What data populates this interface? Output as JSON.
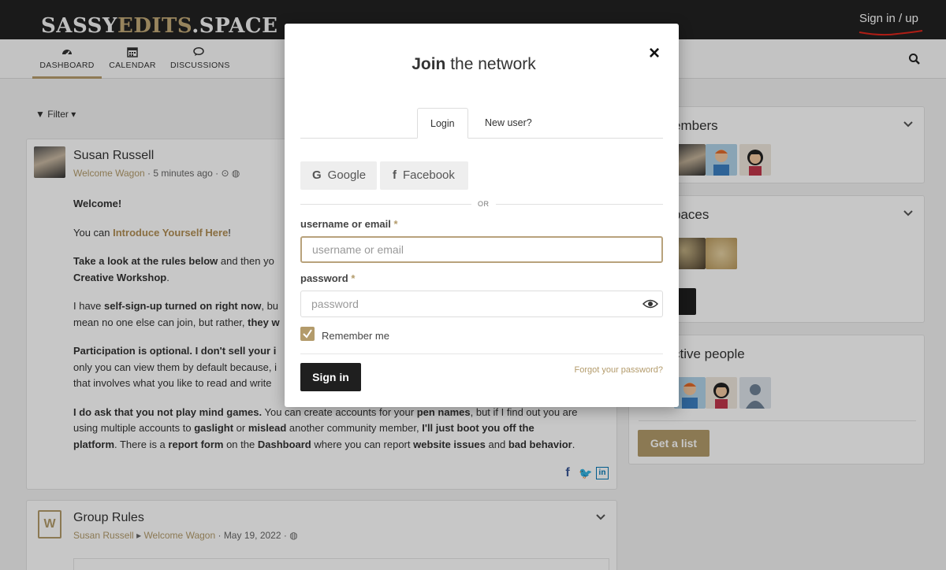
{
  "site": {
    "logo_part1": "SASSY",
    "logo_part2": "EDITS",
    "logo_part3": ".SPACE",
    "signin_link": "Sign in / up",
    "accent_color": "#b39b6b"
  },
  "nav": {
    "items": [
      {
        "label": "DASHBOARD",
        "icon": "dashboard-icon"
      },
      {
        "label": "CALENDAR",
        "icon": "calendar-icon"
      },
      {
        "label": "DISCUSSIONS",
        "icon": "comments-icon"
      }
    ],
    "search_icon": "search-icon"
  },
  "filter_label": "Filter",
  "post1": {
    "author": "Susan Russell",
    "group": "Welcome Wagon",
    "time": "5 minutes ago",
    "p1": "Welcome!",
    "p2_pre": "You can ",
    "p2_link": "Introduce Yourself Here",
    "p2_post": "!",
    "p3_bold": "Take a look at the rules below",
    "p3_rest": " and then yo",
    "p3_line2": "Creative Workshop",
    "p3_line2_end": ".",
    "p4_a": "I have ",
    "p4_b": "self-sign-up turned on right now",
    "p4_c": ", bu",
    "p4_line2_a": "mean no one else can join, but rather, ",
    "p4_line2_b": "they w",
    "p5_a": "Participation is optional. I don't sell your i",
    "p5_line2": "only you can view them by default because, i",
    "p5_line3": "that involves what you like to read and write",
    "p6_a": "I do ask that you not play mind games.",
    "p6_b": " You can create accounts for your ",
    "p6_c": "pen names",
    "p6_d": ", but if I find out you are",
    "p6_line2_a": "using multiple accounts to ",
    "p6_line2_b": "gaslight",
    "p6_line2_c": " or ",
    "p6_line2_d": "mislead",
    "p6_line2_e": " another community member, ",
    "p6_line2_f": "I'll just boot you off the",
    "p6_line3_a": "platform",
    "p6_line3_b": ". There is a ",
    "p6_line3_c": "report form",
    "p6_line3_d": " on the ",
    "p6_line3_e": "Dashboard",
    "p6_line3_f": " where you can report ",
    "p6_line3_g": "website issues",
    "p6_line3_h": " and ",
    "p6_line3_i": "bad behavior",
    "p6_line3_j": "."
  },
  "post2": {
    "title": "Group Rules",
    "author": "Susan Russell",
    "group": "Welcome Wagon",
    "date": "May 19, 2022"
  },
  "sidebar": {
    "members_title": "embers",
    "spaces_title": "paces",
    "active_title": "ctive people",
    "list_button": "Get a list"
  },
  "modal": {
    "title_bold": "Join",
    "title_rest": " the network",
    "close": "×",
    "tab_login": "Login",
    "tab_new": "New user?",
    "google": "Google",
    "facebook": "Facebook",
    "or": "OR",
    "username_label": "username or email",
    "username_placeholder": "username or email",
    "password_label": "password",
    "password_placeholder": "password",
    "required_mark": "*",
    "remember": "Remember me",
    "signin_button": "Sign in",
    "forgot": "Forgot your password?"
  }
}
